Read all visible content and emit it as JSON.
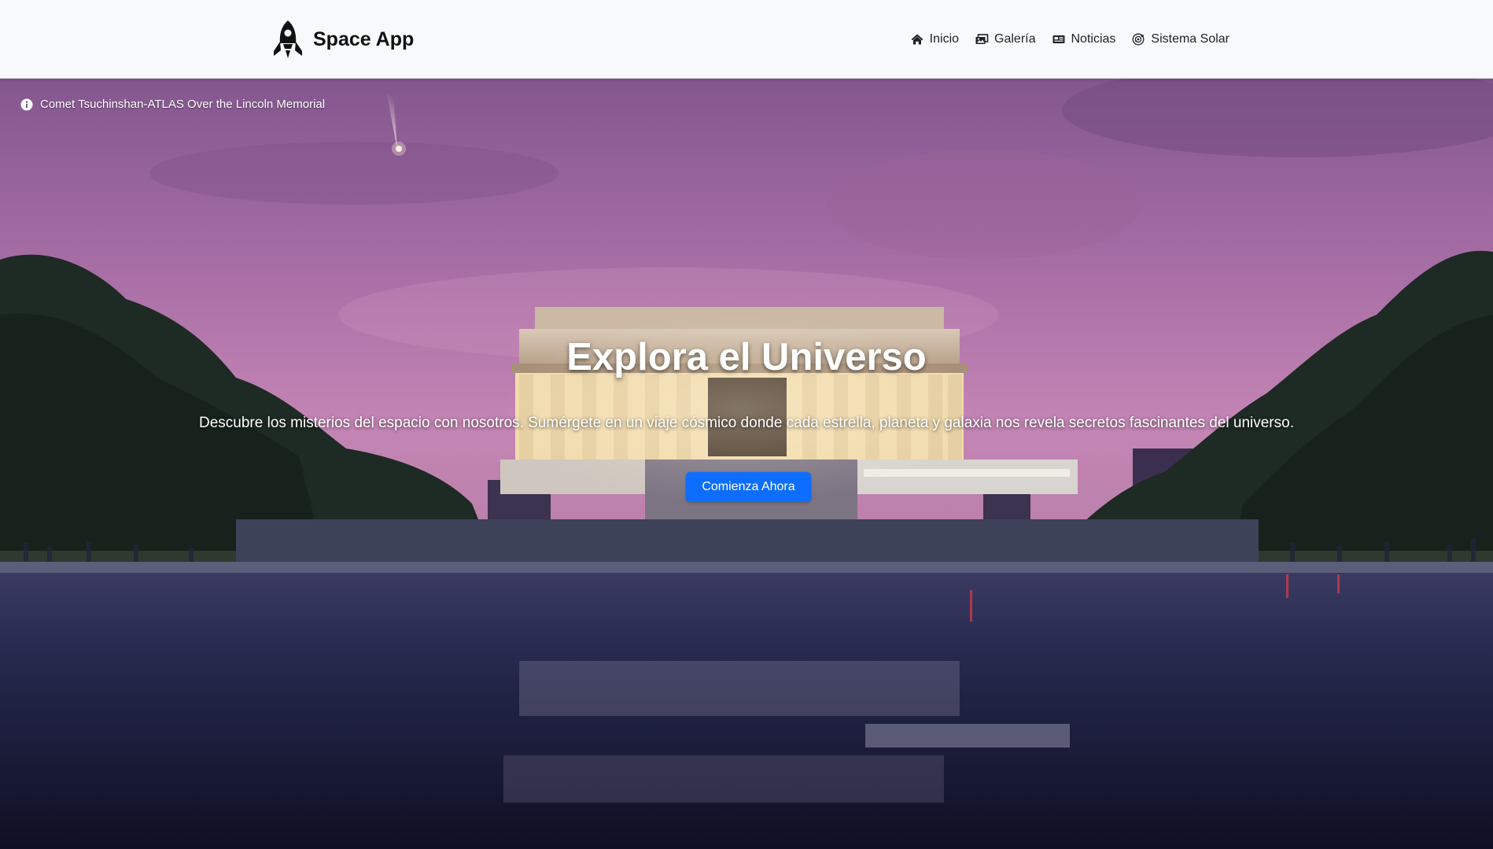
{
  "navbar": {
    "brand": {
      "label": "Space App",
      "icon": "rocket-icon"
    },
    "links": [
      {
        "label": "Inicio",
        "icon": "home-icon"
      },
      {
        "label": "Galería",
        "icon": "images-icon"
      },
      {
        "label": "Noticias",
        "icon": "newspaper-icon"
      },
      {
        "label": "Sistema Solar",
        "icon": "solar-system-icon"
      }
    ]
  },
  "hero": {
    "image_caption": "Comet Tsuchinshan-ATLAS Over the Lincoln Memorial",
    "caption_icon": "info-icon",
    "title": "Explora el Universo",
    "subtitle": "Descubre los misterios del espacio con nosotros. Sumérgete en un viaje cósmico donde cada estrella, planeta y galaxia nos revela secretos fascinantes del universo.",
    "button_label": "Comienza Ahora"
  },
  "colors": {
    "navbar_bg": "#f8f9fa",
    "primary": "#0d6efd",
    "sky_top": "#8a5a96",
    "sky_mid": "#c081b3",
    "water": "#1a1d3a"
  }
}
